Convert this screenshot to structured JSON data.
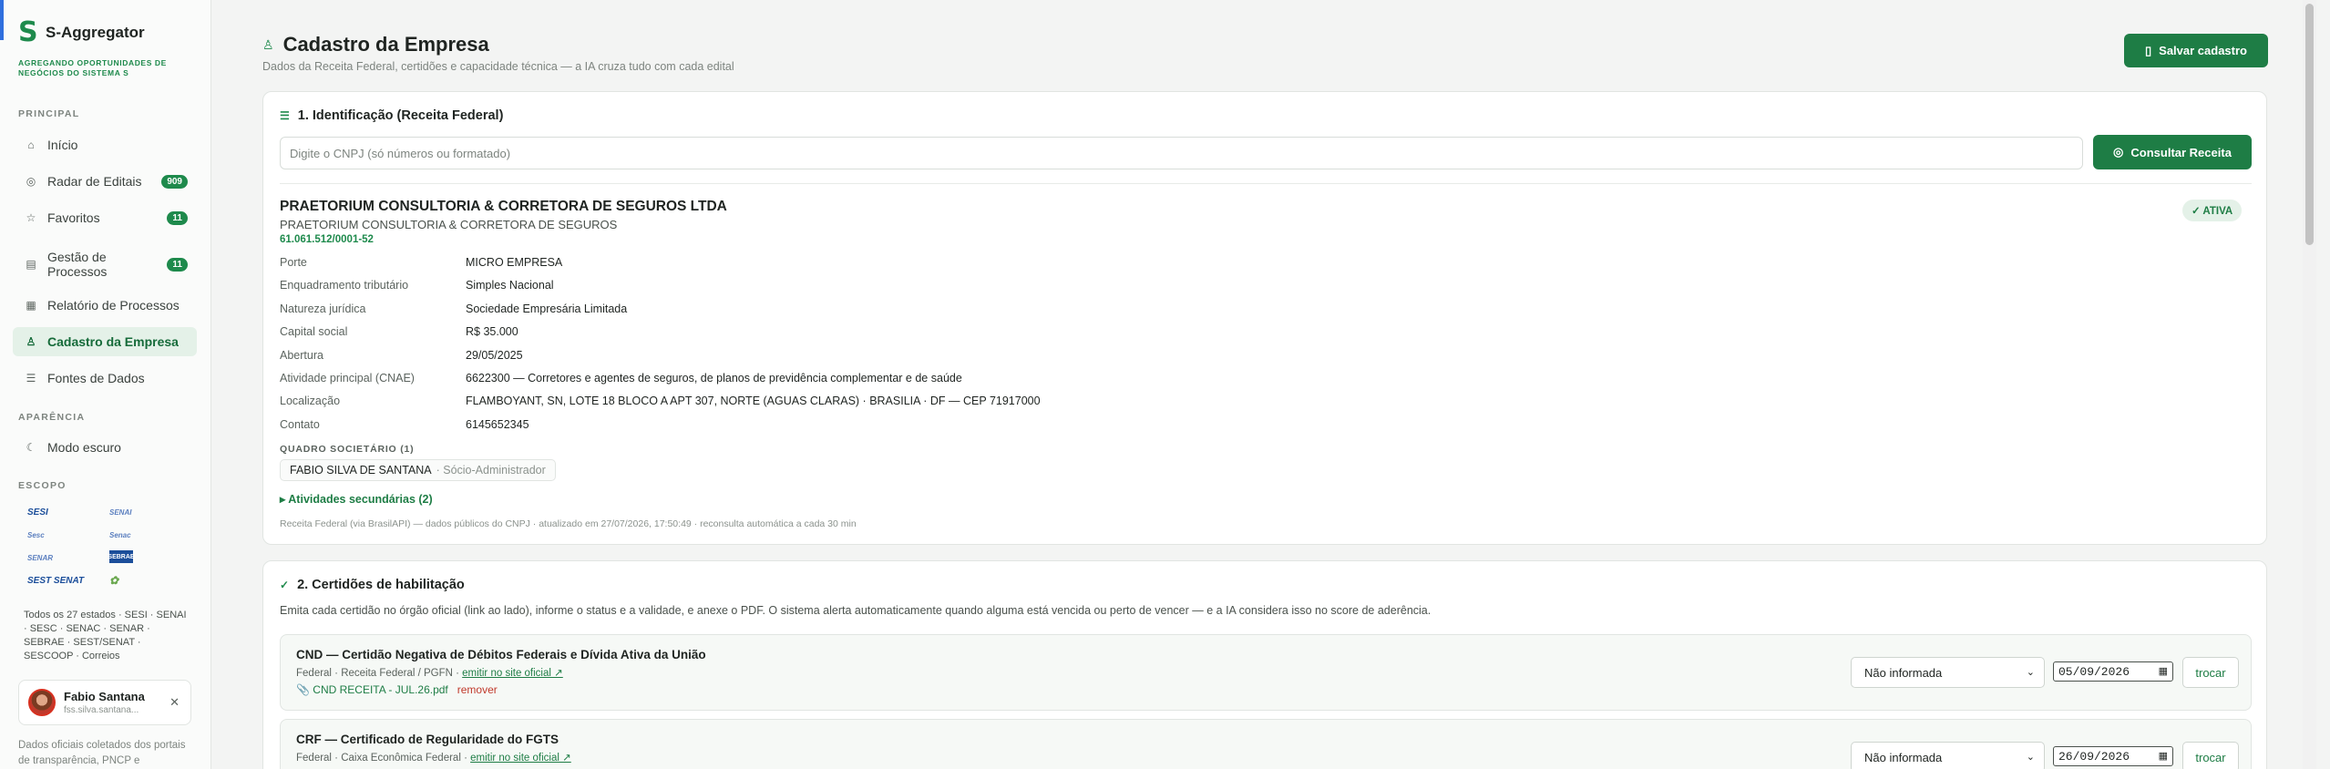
{
  "app": {
    "name": "S-Aggregator",
    "tagline": "AGREGANDO OPORTUNIDADES DE NEGÓCIOS DO SISTEMA S"
  },
  "sidebar": {
    "section_principal": "PRINCIPAL",
    "items": [
      {
        "label": "Início",
        "icon": "home-icon"
      },
      {
        "label": "Radar de Editais",
        "icon": "radar-icon",
        "badge": "909"
      },
      {
        "label": "Favoritos",
        "icon": "star-icon",
        "badge": "11"
      },
      {
        "label": "Gestão de Processos",
        "icon": "kanban-icon",
        "badge": "11"
      },
      {
        "label": "Relatório de Processos",
        "icon": "table-icon"
      },
      {
        "label": "Cadastro da Empresa",
        "icon": "user-icon",
        "active": true
      },
      {
        "label": "Fontes de Dados",
        "icon": "database-icon"
      }
    ],
    "section_aparencia": "APARÊNCIA",
    "dark_mode_label": "Modo escuro",
    "section_escopo": "ESCOPO",
    "scope_logos": [
      "SESI",
      "SENAI",
      "Sesc",
      "Senac",
      "SENAR",
      "SEBRAE",
      "SEST SENAT",
      "SESCOOP"
    ],
    "scope_text": "Todos os 27 estados · SESI · SENAI · SESC · SENAC · SENAR · SEBRAE · SEST/SENAT · SESCOOP · Correios",
    "user": {
      "name": "Fabio Santana",
      "email": "fss.silva.santana..."
    },
    "footer_note": "Dados oficiais coletados dos portais de transparência, PNCP e"
  },
  "page": {
    "title": "Cadastro da Empresa",
    "subtitle": "Dados da Receita Federal, certidões e capacidade técnica — a IA cruza tudo com cada edital",
    "save_label": "Salvar cadastro"
  },
  "identificacao": {
    "heading": "1. Identificação (Receita Federal)",
    "cnpj_placeholder": "Digite o CNPJ (só números ou formatado)",
    "consult_label": "Consultar Receita",
    "razao_social": "PRAETORIUM CONSULTORIA & CORRETORA DE SEGUROS LTDA",
    "nome_fantasia": "PRAETORIUM CONSULTORIA & CORRETORA DE SEGUROS",
    "cnpj": "61.061.512/0001-52",
    "status": "✓ ATIVA",
    "fields": [
      {
        "k": "Porte",
        "v": "MICRO EMPRESA"
      },
      {
        "k": "Enquadramento tributário",
        "v": "Simples Nacional"
      },
      {
        "k": "Natureza jurídica",
        "v": "Sociedade Empresária Limitada"
      },
      {
        "k": "Capital social",
        "v": "R$ 35.000"
      },
      {
        "k": "Abertura",
        "v": "29/05/2025"
      },
      {
        "k": "Atividade principal (CNAE)",
        "v": "6622300 — Corretores e agentes de seguros, de planos de previdência complementar e de saúde"
      },
      {
        "k": "Localização",
        "v": "FLAMBOYANT, SN, LOTE 18 BLOCO A APT 307, NORTE (AGUAS CLARAS) · BRASILIA · DF — CEP 71917000"
      },
      {
        "k": "Contato",
        "v": "6145652345"
      }
    ],
    "quadro_label": "QUADRO SOCIETÁRIO (1)",
    "socio_name": "FABIO SILVA DE SANTANA",
    "socio_role": "· Sócio-Administrador",
    "secondary_label": "▸ Atividades secundárias (2)",
    "source_note": "Receita Federal (via BrasilAPI) — dados públicos do CNPJ · atualizado em 27/07/2026, 17:50:49 · reconsulta automática a cada 30 min"
  },
  "certidoes": {
    "heading": "2. Certidões de habilitação",
    "description": "Emita cada certidão no órgão oficial (link ao lado), informe o status e a validade, e anexe o PDF. O sistema alerta automaticamente quando alguma está vencida ou perto de vencer — e a IA considera isso no score de aderência.",
    "items": [
      {
        "title": "CND — Certidão Negativa de Débitos Federais e Dívida Ativa da União",
        "meta": "Federal · Receita Federal / PGFN · ",
        "link": "emitir no site oficial ↗",
        "file": "📎 CND RECEITA - JUL.26.pdf",
        "remove": "remover",
        "status": "Não informada",
        "date": "05/09/2026",
        "swap": "trocar"
      },
      {
        "title": "CRF — Certificado de Regularidade do FGTS",
        "meta": "Federal · Caixa Econômica Federal · ",
        "link": "emitir no site oficial ↗",
        "status": "Não informada",
        "date": "26/09/2026",
        "swap": "trocar"
      }
    ]
  },
  "colors": {
    "accent": "#1e7d45",
    "accent_light": "#e4f1e8",
    "danger": "#c0392b"
  }
}
